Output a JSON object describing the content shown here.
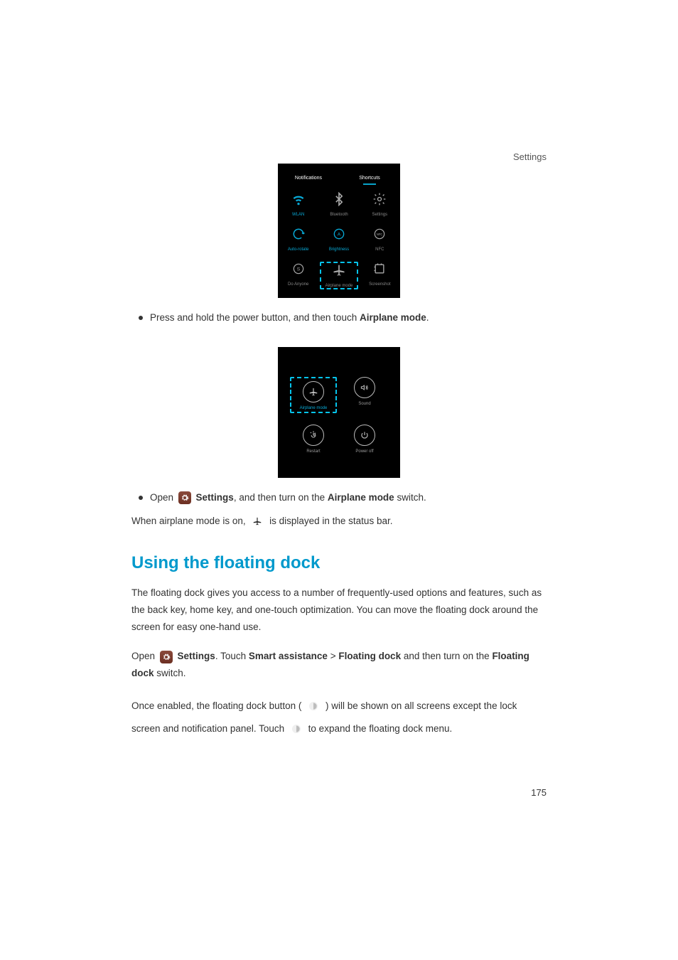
{
  "header": {
    "section": "Settings"
  },
  "shortcutsPanel": {
    "tabs": {
      "left": "Notifications",
      "right": "Shortcuts"
    },
    "items": {
      "wifi": {
        "label": "WLAN"
      },
      "bluetooth": {
        "label": "Bluetooth"
      },
      "settings": {
        "label": "Settings"
      },
      "rotate": {
        "label": "Auto-rotate"
      },
      "brightness": {
        "label": "Brightness"
      },
      "nfc": {
        "label": "NFC"
      },
      "do_anyone": {
        "label": "Do Anyone"
      },
      "airplane": {
        "label": "Airplane mode"
      },
      "screenshot": {
        "label": "Screenshot"
      }
    }
  },
  "bullet1": {
    "prefix": "Press and hold the power button, and then touch ",
    "bold": "Airplane mode",
    "suffix": "."
  },
  "powerPanel": {
    "airplane": "Airplane mode",
    "sound": "Sound",
    "restart": "Restart",
    "poweroff": "Power off"
  },
  "bullet2": {
    "open": "Open ",
    "settings": "Settings",
    "mid": ", and then turn on the ",
    "bold": "Airplane mode",
    "suffix": " switch."
  },
  "statusLine": {
    "prefix": "When airplane mode is on, ",
    "suffix": " is displayed in the status bar."
  },
  "sectionTitle": "Using the floating dock",
  "para1": "The floating dock gives you access to a number of frequently-used options and features, such as the back key, home key, and one-touch optimization. You can move the floating dock around the screen for easy one-hand use.",
  "para2": {
    "open": "Open ",
    "settings": "Settings",
    "t1": ". Touch ",
    "b1": "Smart assistance",
    "gt": " > ",
    "b2": "Floating dock",
    "t2": " and then turn on the ",
    "b3": "Floating dock",
    "t3": " switch."
  },
  "para3": {
    "p1": "Once enabled, the floating dock button (",
    "p2": ") will be shown on all screens except the lock screen and notification panel. Touch ",
    "p3": " to expand the floating dock menu."
  },
  "pageNumber": "175"
}
